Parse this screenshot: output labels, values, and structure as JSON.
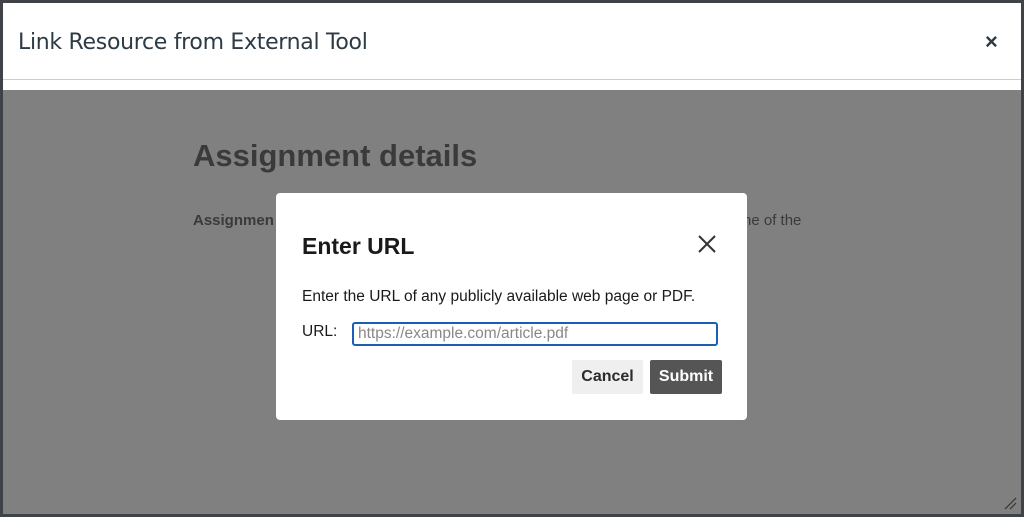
{
  "outer_modal": {
    "title": "Link Resource from External Tool",
    "close_glyph": "×"
  },
  "background_page": {
    "heading": "Assignment details",
    "subtext_left": "Assignmen",
    "subtext_right": "ne of the"
  },
  "url_dialog": {
    "title": "Enter URL",
    "close_icon": "close-icon",
    "description": "Enter the URL of any publicly available web page or PDF.",
    "url_label": "URL:",
    "url_value": "",
    "url_placeholder": "https://example.com/article.pdf",
    "cancel_label": "Cancel",
    "submit_label": "Submit"
  },
  "colors": {
    "overlay": "#808080",
    "submit_bg": "#555555",
    "input_focus_border": "#1a5fb4"
  }
}
